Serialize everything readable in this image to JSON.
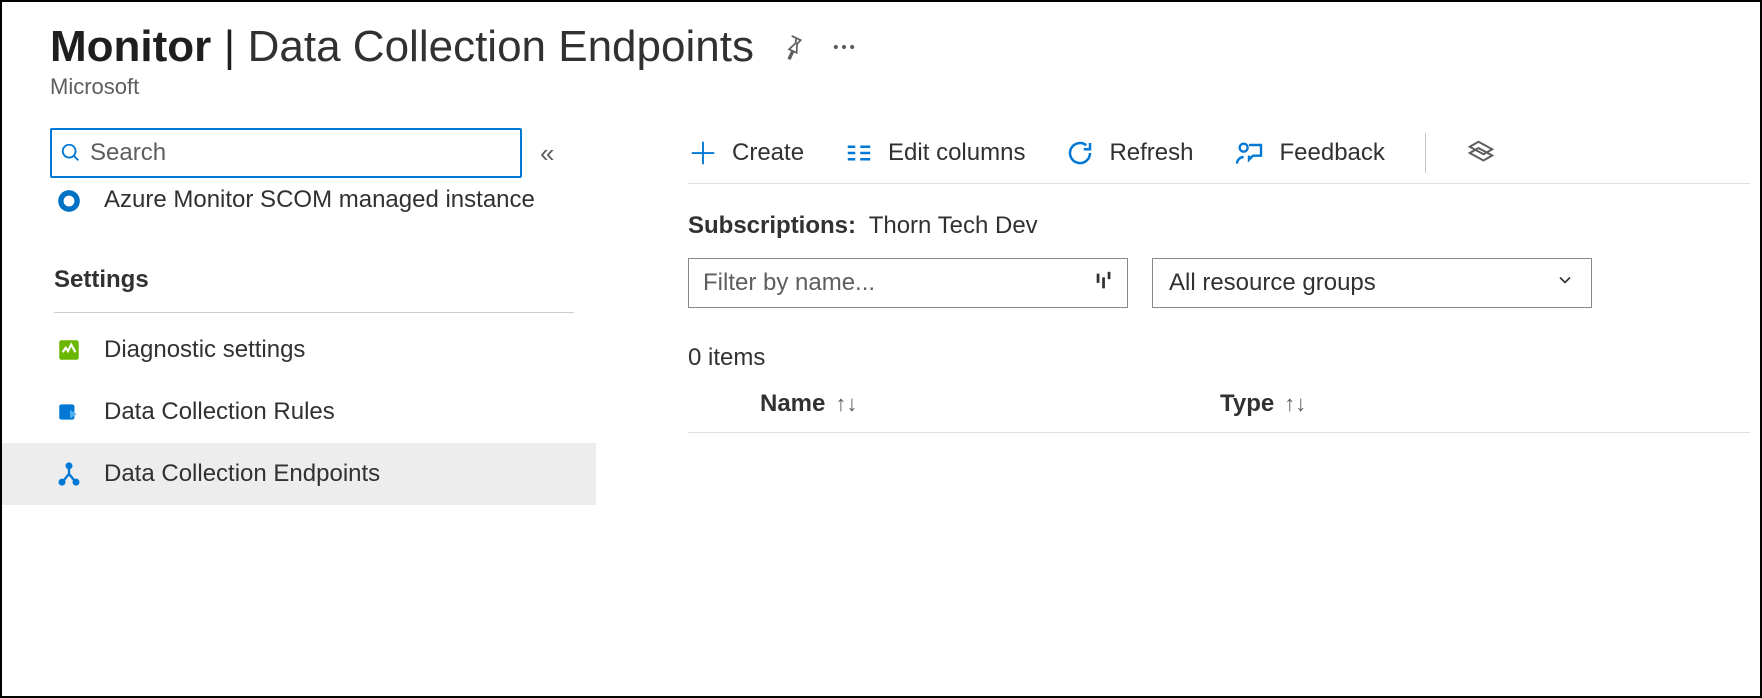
{
  "header": {
    "title_strong": "Monitor",
    "title_separator": "|",
    "title_light": "Data Collection Endpoints",
    "subtitle": "Microsoft"
  },
  "sidebar": {
    "search_placeholder": "Search",
    "partial_item": {
      "label": "Azure Monitor SCOM managed instance"
    },
    "settings_heading": "Settings",
    "settings_items": [
      {
        "label": "Diagnostic settings",
        "selected": false
      },
      {
        "label": "Data Collection Rules",
        "selected": false
      },
      {
        "label": "Data Collection Endpoints",
        "selected": true
      }
    ]
  },
  "toolbar": {
    "create": "Create",
    "edit_columns": "Edit columns",
    "refresh": "Refresh",
    "feedback": "Feedback"
  },
  "content": {
    "subscriptions_label": "Subscriptions:",
    "subscriptions_value": "Thorn Tech Dev",
    "filter_placeholder": "Filter by name...",
    "resource_group_selected": "All resource groups",
    "item_count": "0 items",
    "columns": {
      "name": "Name",
      "type": "Type"
    },
    "rows": []
  }
}
